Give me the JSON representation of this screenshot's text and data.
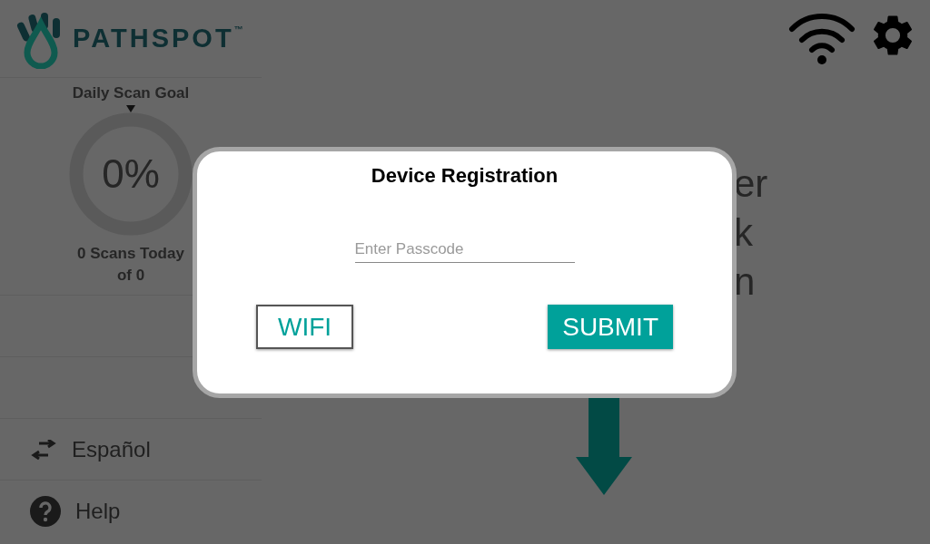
{
  "logo": {
    "wordmark": "PATHSPOT",
    "trademark": "™"
  },
  "daily_goal": {
    "title": "Daily Scan Goal",
    "percent": "0%",
    "level": 0,
    "scans": "0 Scans Today",
    "of": "of 0"
  },
  "sidebar": {
    "items": [
      {
        "kind": "language",
        "label": "Español"
      },
      {
        "kind": "help",
        "label": "Help"
      }
    ]
  },
  "background_text": [
    "er",
    "k",
    "n"
  ],
  "dialog": {
    "title": "Device Registration",
    "passcode": {
      "placeholder": "Enter Passcode"
    },
    "buttons": [
      {
        "kind": "outline",
        "label": "WIFI"
      },
      {
        "kind": "primary",
        "label": "SUBMIT"
      }
    ]
  }
}
